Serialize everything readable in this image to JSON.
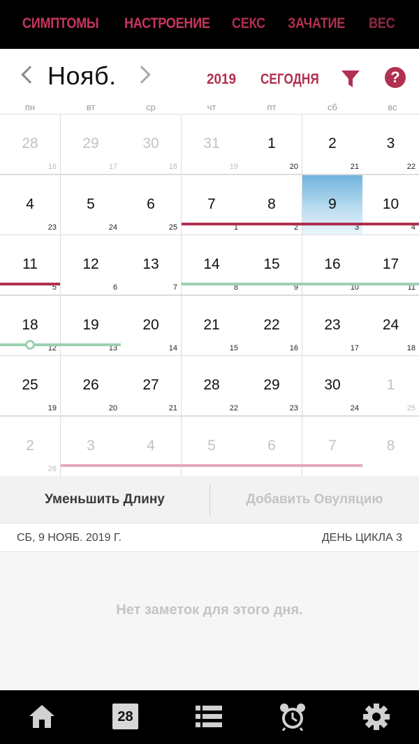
{
  "top_tabs": [
    {
      "label": "СИМПТОМЫ"
    },
    {
      "label": "НАСТРОЕНИЕ"
    },
    {
      "label": "СЕКС"
    },
    {
      "label": "ЗАЧАТИЕ"
    },
    {
      "label": "ВЕС"
    }
  ],
  "header": {
    "month": "Нояб.",
    "year": "2019",
    "today_label": "СЕГОДНЯ",
    "help_glyph": "?",
    "filter_icon": "filter-icon",
    "accent_color": "#b0304f"
  },
  "weekdays": [
    "пн",
    "вт",
    "ср",
    "чт",
    "пт",
    "сб",
    "вс"
  ],
  "calendar": {
    "rows": [
      [
        {
          "d": "28",
          "c": "16",
          "o": true
        },
        {
          "d": "29",
          "c": "17",
          "o": true
        },
        {
          "d": "30",
          "c": "18",
          "o": true
        },
        {
          "d": "31",
          "c": "19",
          "o": true
        },
        {
          "d": "1",
          "c": "20"
        },
        {
          "d": "2",
          "c": "21"
        },
        {
          "d": "3",
          "c": "22"
        }
      ],
      [
        {
          "d": "4",
          "c": "23"
        },
        {
          "d": "5",
          "c": "24"
        },
        {
          "d": "6",
          "c": "25"
        },
        {
          "d": "7",
          "c": "1"
        },
        {
          "d": "8",
          "c": "2"
        },
        {
          "d": "9",
          "c": "3",
          "sel": true
        },
        {
          "d": "10",
          "c": "4"
        }
      ],
      [
        {
          "d": "11",
          "c": "5"
        },
        {
          "d": "12",
          "c": "6"
        },
        {
          "d": "13",
          "c": "7"
        },
        {
          "d": "14",
          "c": "8"
        },
        {
          "d": "15",
          "c": "9"
        },
        {
          "d": "16",
          "c": "10"
        },
        {
          "d": "17",
          "c": "11"
        }
      ],
      [
        {
          "d": "18",
          "c": "12"
        },
        {
          "d": "19",
          "c": "13"
        },
        {
          "d": "20",
          "c": "14"
        },
        {
          "d": "21",
          "c": "15"
        },
        {
          "d": "22",
          "c": "16"
        },
        {
          "d": "23",
          "c": "17"
        },
        {
          "d": "24",
          "c": "18"
        }
      ],
      [
        {
          "d": "25",
          "c": "19"
        },
        {
          "d": "26",
          "c": "20"
        },
        {
          "d": "27",
          "c": "21"
        },
        {
          "d": "28",
          "c": "22"
        },
        {
          "d": "29",
          "c": "23"
        },
        {
          "d": "30",
          "c": "24"
        },
        {
          "d": "1",
          "c": "25",
          "o": true
        }
      ],
      [
        {
          "d": "2",
          "c": "26",
          "o": true
        },
        {
          "d": "3",
          "c": "",
          "o": true
        },
        {
          "d": "4",
          "c": "",
          "o": true
        },
        {
          "d": "5",
          "c": "",
          "o": true
        },
        {
          "d": "6",
          "c": "",
          "o": true
        },
        {
          "d": "7",
          "c": "",
          "o": true
        },
        {
          "d": "8",
          "c": "",
          "o": true
        }
      ]
    ],
    "bars": [
      {
        "type": "period",
        "row": 1,
        "from": 3,
        "to": 6
      },
      {
        "type": "period",
        "row": 2,
        "from": 0,
        "to": 0
      },
      {
        "type": "fertile",
        "row": 2,
        "from": 3,
        "to": 6
      },
      {
        "type": "fertile",
        "row": 3,
        "from": 0,
        "to": 1
      },
      {
        "type": "pred",
        "row": 5,
        "from": 1,
        "to": 5
      }
    ],
    "ovulation": {
      "row": 3,
      "col": 0
    },
    "colors": {
      "period": "#b0304f",
      "fertile": "#9ccfb0",
      "predicted_period": "#e3a8c0",
      "selected": "#6fb3dc"
    }
  },
  "actions": {
    "shorten_label": "Уменьшить Длину",
    "add_ovulation_label": "Добавить Овуляцию"
  },
  "day_info": {
    "date": "СБ, 9 НОЯБ. 2019 Г.",
    "cycle_day": "ДЕНЬ ЦИКЛА 3"
  },
  "notes": {
    "empty_text": "Нет заметок для этого дня."
  },
  "bottom_nav": {
    "items": [
      "home-icon",
      "calendar-icon",
      "list-icon",
      "alarm-clock-icon",
      "gear-icon"
    ],
    "calendar_badge": "28"
  }
}
